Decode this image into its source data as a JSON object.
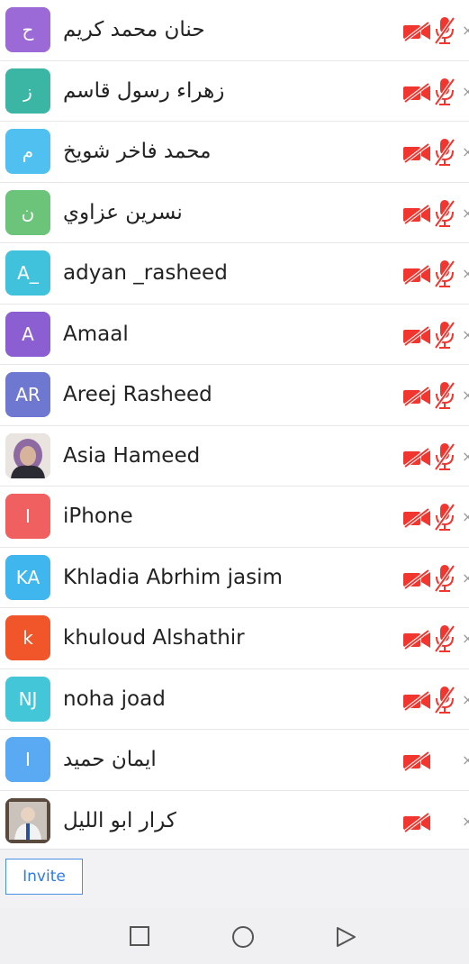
{
  "participants": [
    {
      "name": "حنان محمد كريم",
      "initials": "ح",
      "color": "#9c6ad6",
      "avatar_type": "initials",
      "video_muted": true,
      "mic_muted": true
    },
    {
      "name": "زهراء رسول قاسم",
      "initials": "ز",
      "color": "#3bb5a4",
      "avatar_type": "initials",
      "video_muted": true,
      "mic_muted": true
    },
    {
      "name": "محمد فاخر شويخ",
      "initials": "م",
      "color": "#4fc0f0",
      "avatar_type": "initials",
      "video_muted": true,
      "mic_muted": true
    },
    {
      "name": "نسرين عزاوي",
      "initials": "ن",
      "color": "#6cc47a",
      "avatar_type": "initials",
      "video_muted": true,
      "mic_muted": true
    },
    {
      "name": "adyan _rasheed",
      "initials": "A_",
      "color": "#40c2dc",
      "avatar_type": "initials",
      "video_muted": true,
      "mic_muted": true
    },
    {
      "name": "Amaal",
      "initials": "A",
      "color": "#8b5fd1",
      "avatar_type": "initials",
      "video_muted": true,
      "mic_muted": true
    },
    {
      "name": "Areej Rasheed",
      "initials": "AR",
      "color": "#6f78d0",
      "avatar_type": "initials",
      "video_muted": true,
      "mic_muted": true
    },
    {
      "name": "Asia Hameed",
      "initials": "",
      "color": "#d9cfc6",
      "avatar_type": "photo",
      "video_muted": true,
      "mic_muted": true
    },
    {
      "name": "iPhone",
      "initials": "I",
      "color": "#f06060",
      "avatar_type": "initials",
      "video_muted": true,
      "mic_muted": true
    },
    {
      "name": "Khladia Abrhim jasim",
      "initials": "KA",
      "color": "#3fb6ee",
      "avatar_type": "initials",
      "video_muted": true,
      "mic_muted": true
    },
    {
      "name": "khuloud Alshathir",
      "initials": "k",
      "color": "#f0562a",
      "avatar_type": "initials",
      "video_muted": true,
      "mic_muted": true
    },
    {
      "name": "noha joad",
      "initials": "NJ",
      "color": "#43c6d8",
      "avatar_type": "initials",
      "video_muted": true,
      "mic_muted": true
    },
    {
      "name": "ايمان حميد",
      "initials": "I",
      "color": "#5aa9f3",
      "avatar_type": "initials",
      "video_muted": true,
      "mic_muted": false
    },
    {
      "name": "كرار ابو الليل",
      "initials": "",
      "color": "#6f5f54",
      "avatar_type": "photo",
      "video_muted": true,
      "mic_muted": false
    }
  ],
  "footer": {
    "invite_label": "Invite"
  },
  "icons": {
    "video": "video-off-icon",
    "mic": "mic-off-icon",
    "more": "close-x-icon",
    "muted_color": "#f0362f"
  },
  "navbar": {
    "buttons": [
      "recents-square-icon",
      "home-circle-icon",
      "back-triangle-icon"
    ]
  }
}
